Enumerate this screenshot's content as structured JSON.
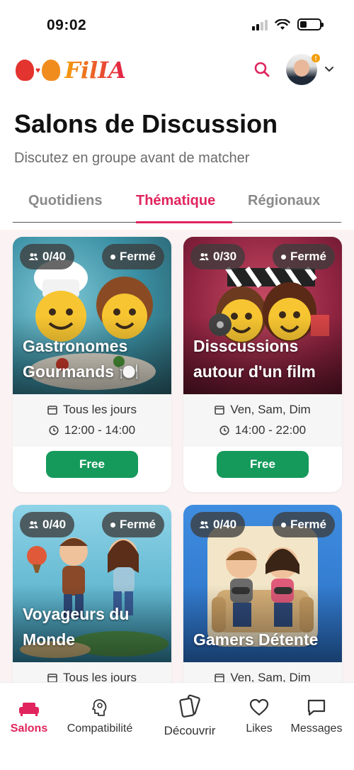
{
  "status_bar": {
    "time": "09:02"
  },
  "header": {
    "logo_text": "FilIA",
    "icons": {
      "search": "search-icon",
      "avatar_chevron": "chevron-down-icon"
    },
    "notification_badge": "!"
  },
  "page": {
    "title": "Salons de Discussion",
    "subtitle": "Discutez en groupe avant de matcher"
  },
  "tabs": [
    {
      "label": "Quotidiens",
      "active": false
    },
    {
      "label": "Thématique",
      "active": true
    },
    {
      "label": "Régionaux",
      "active": false
    }
  ],
  "cards": [
    {
      "count": "0/40",
      "status": "Fermé",
      "title": "Gastronomes Gourmands 🍽️",
      "days": "Tous les jours",
      "hours": "12:00 - 14:00",
      "button": "Free"
    },
    {
      "count": "0/30",
      "status": "Fermé",
      "title": "Disscussions autour d'un film",
      "days": "Ven, Sam, Dim",
      "hours": "14:00 - 22:00",
      "button": "Free"
    },
    {
      "count": "0/40",
      "status": "Fermé",
      "title": "Voyageurs du Monde",
      "days": "Tous les jours"
    },
    {
      "count": "0/40",
      "status": "Fermé",
      "title": "Gamers Détente",
      "days": "Ven, Sam, Dim"
    }
  ],
  "bottom_nav": [
    {
      "label": "Salons",
      "icon": "sofa-icon",
      "active": true
    },
    {
      "label": "Compatibilité",
      "icon": "brain-head-icon",
      "active": false
    },
    {
      "label": "Découvrir",
      "icon": "cards-icon",
      "active": false
    },
    {
      "label": "Likes",
      "icon": "heart-icon",
      "active": false
    },
    {
      "label": "Messages",
      "icon": "chat-icon",
      "active": false
    }
  ],
  "colors": {
    "accent": "#e0245e",
    "free_button": "#159a5c",
    "badge": "#f59e0b"
  }
}
